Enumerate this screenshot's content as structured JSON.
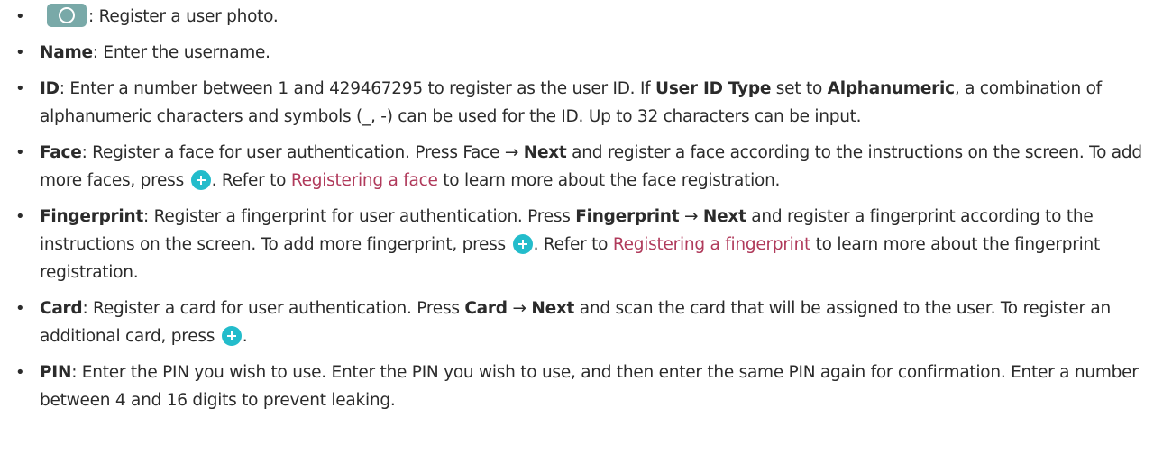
{
  "colors": {
    "link": "#b03a5b",
    "camera_button": "#79a9a8",
    "plus_button": "#23bccb"
  },
  "icons": {
    "camera": "camera-icon",
    "plus": "plus-icon"
  },
  "bullet": "•",
  "arrow": "→",
  "items": {
    "photo": {
      "desc": ": Register a user photo."
    },
    "name": {
      "term": "Name",
      "desc": ": Enter the username."
    },
    "id": {
      "term": "ID",
      "t1": ": Enter a number between 1 and 429467295 to register as the user ID. If ",
      "b1": "User ID Type",
      "t2": " set to ",
      "b2": "Alphanumeric",
      "t3": ", a combination of alphanumeric characters and symbols (_, -) can be used for the ID. Up to 32 characters can be input."
    },
    "face": {
      "term": "Face",
      "t1": ": Register a face for user authentication. Press Face ",
      "b1": "Next",
      "t2": " and register a face according to the instructions on the screen. To add more faces, press ",
      "t3": ". Refer to ",
      "link": "Registering a face",
      "t4": " to learn more about the face registration."
    },
    "fingerprint": {
      "term": "Fingerprint",
      "t1": ": Register a fingerprint for user authentication. Press ",
      "b1": "Fingerprint",
      "b2": "Next",
      "t2": " and register a fingerprint according to the instructions on the screen. To add more fingerprint, press ",
      "t3": ". Refer to ",
      "link": "Registering a fingerprint",
      "t4": " to learn more about the fingerprint registration."
    },
    "card": {
      "term": "Card",
      "t1": ": Register a card for user authentication. Press ",
      "b1": "Card",
      "b2": "Next",
      "t2": " and scan the card that will be assigned to the user. To register an additional card, press ",
      "t3": "."
    },
    "pin": {
      "term": "PIN",
      "desc": ": Enter the PIN you wish to use. Enter the PIN you wish to use, and then enter the same PIN again for confirmation. Enter a number between 4 and 16 digits to prevent leaking."
    }
  }
}
